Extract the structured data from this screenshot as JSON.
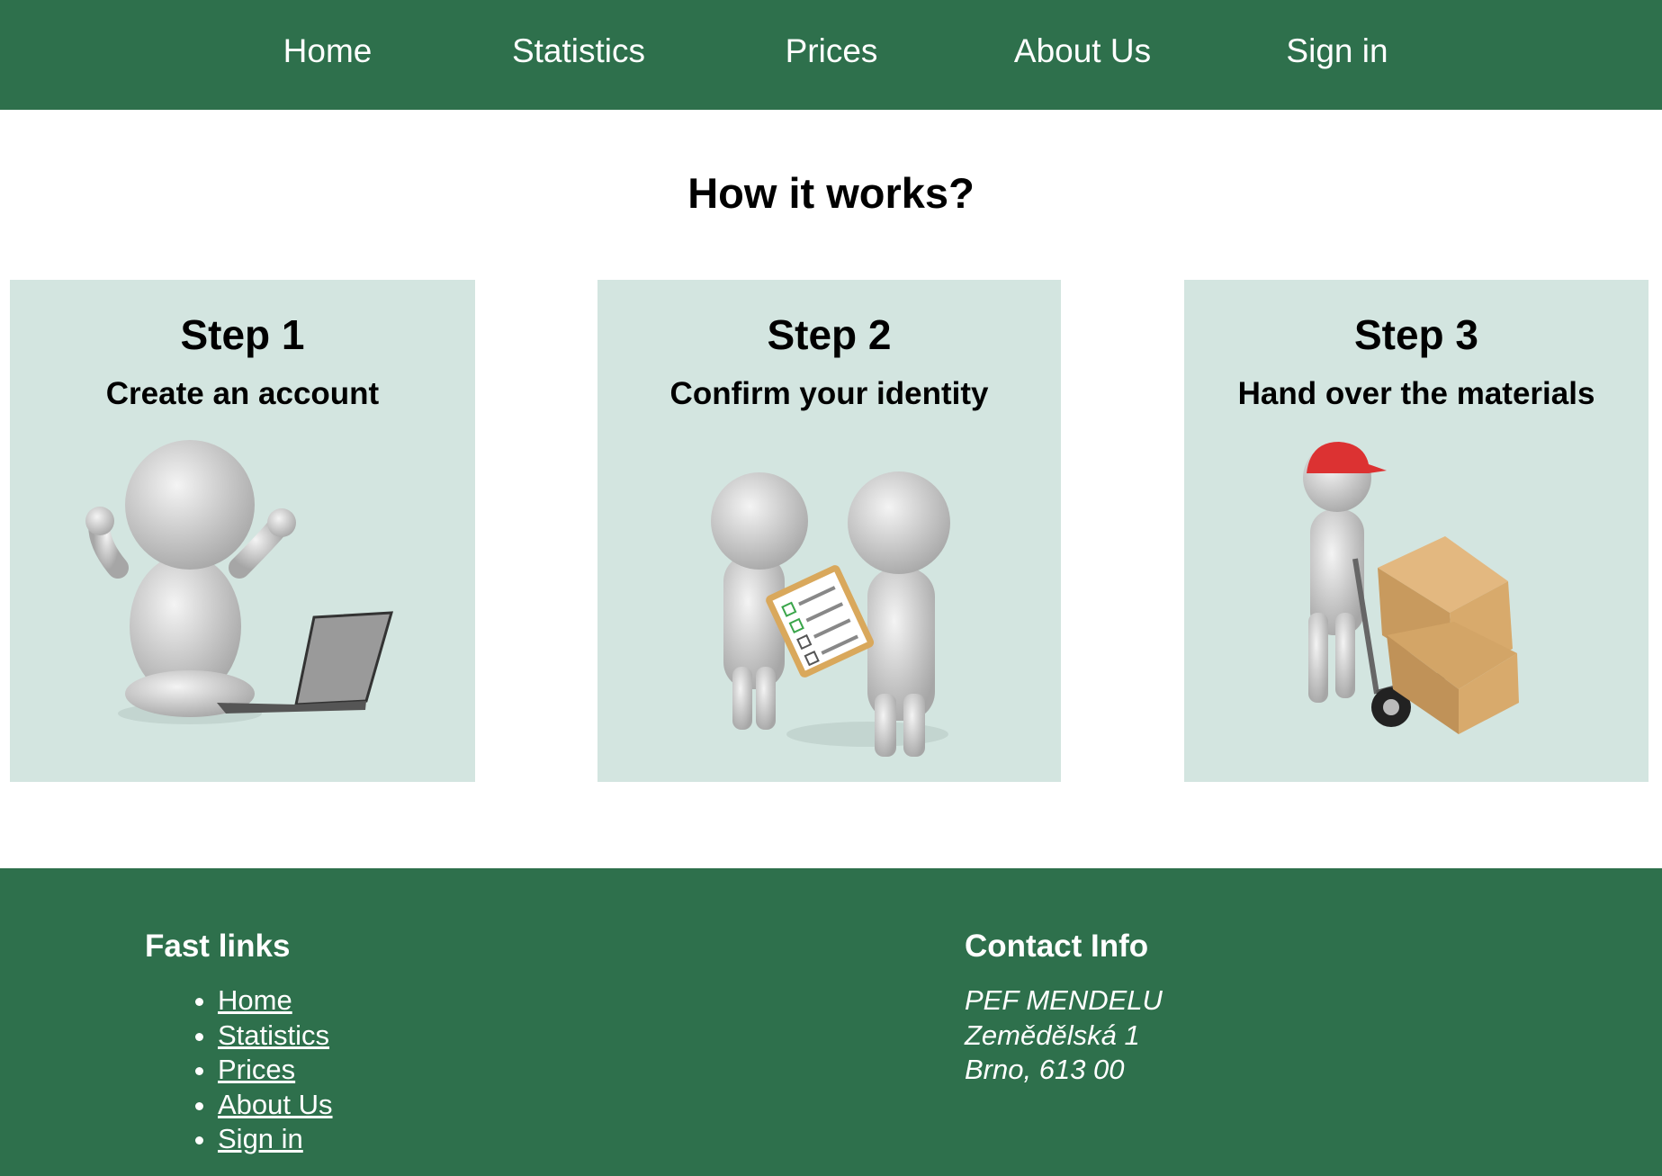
{
  "nav": {
    "items": [
      {
        "label": "Home"
      },
      {
        "label": "Statistics"
      },
      {
        "label": "Prices"
      },
      {
        "label": "About Us"
      },
      {
        "label": "Sign in"
      }
    ]
  },
  "main": {
    "heading": "How it works?",
    "steps": [
      {
        "title": "Step 1",
        "subtitle": "Create an account",
        "illustration": "person-with-laptop"
      },
      {
        "title": "Step 2",
        "subtitle": "Confirm your identity",
        "illustration": "two-people-checklist"
      },
      {
        "title": "Step 3",
        "subtitle": "Hand over the materials",
        "illustration": "delivery-person-boxes"
      }
    ]
  },
  "footer": {
    "links_title": "Fast links",
    "links": [
      "Home",
      "Statistics",
      "Prices",
      "About Us",
      "Sign in"
    ],
    "contact_title": "Contact Info",
    "contact_lines": [
      "PEF MENDELU",
      "Zemědělská 1",
      "Brno, 613 00"
    ]
  },
  "colors": {
    "brand_green": "#2e704c",
    "card_bg": "#d3e5e0",
    "text": "#000000"
  }
}
